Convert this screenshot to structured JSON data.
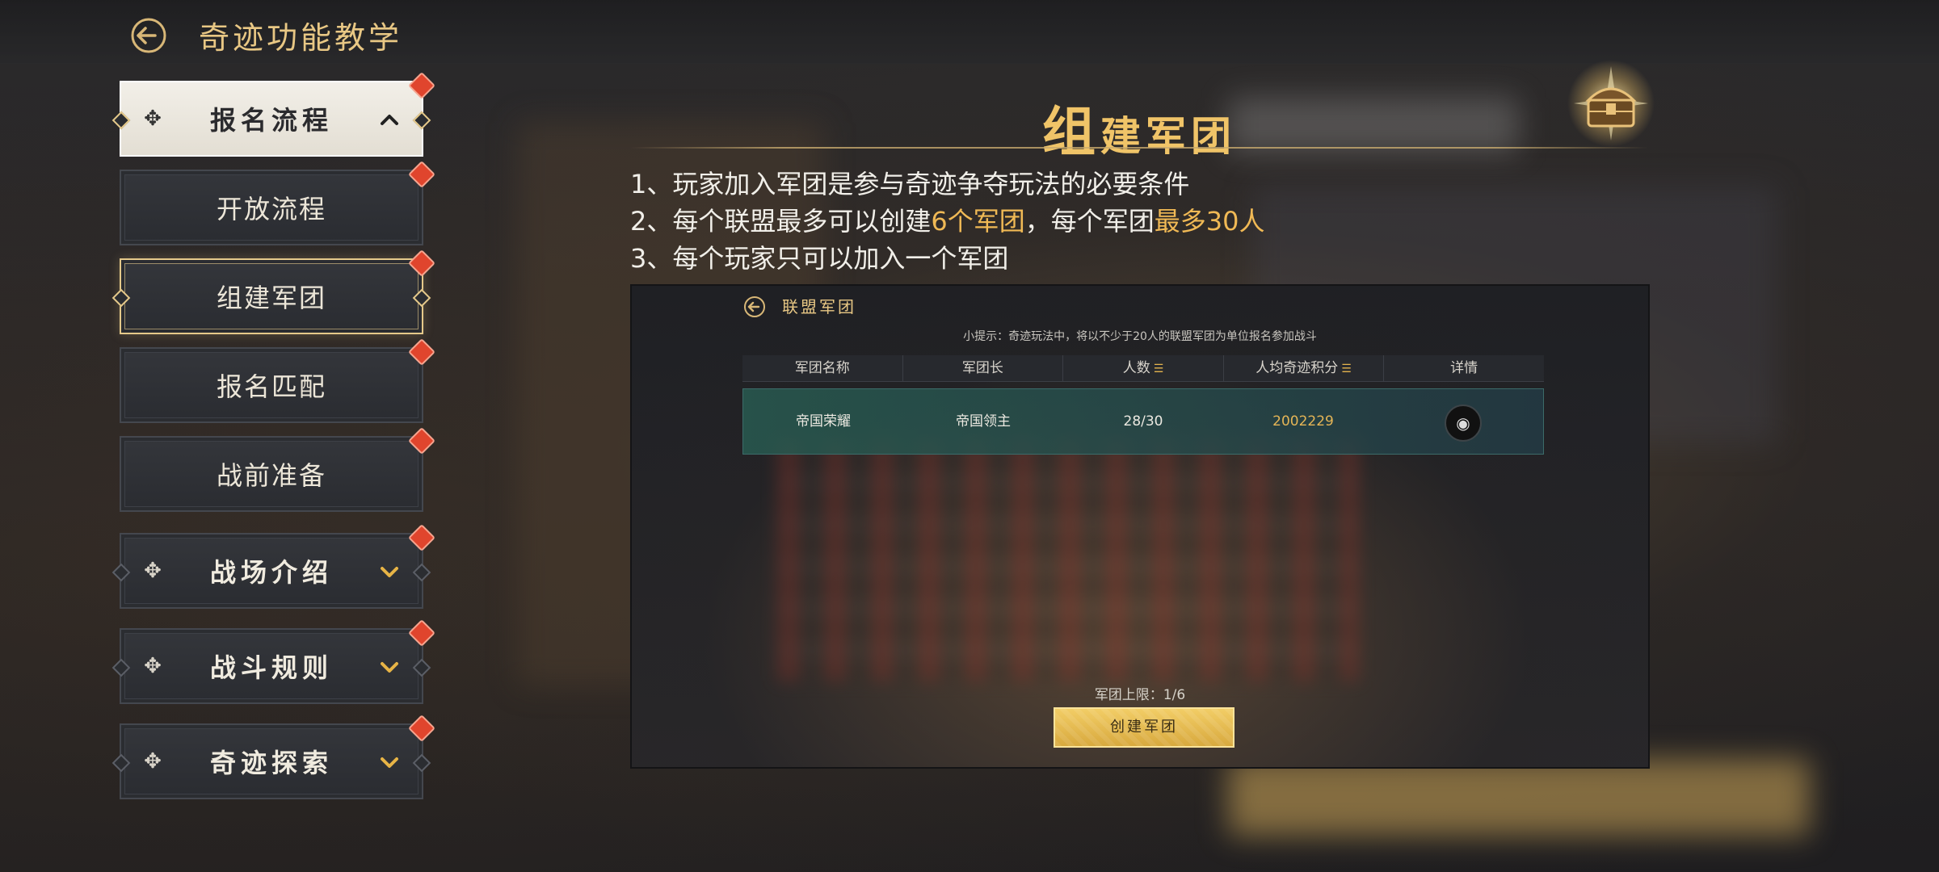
{
  "header": {
    "title": "奇迹功能教学"
  },
  "sidebar": {
    "items": [
      {
        "label": "报名流程",
        "type": "category",
        "state": "expanded"
      },
      {
        "label": "开放流程",
        "type": "sub"
      },
      {
        "label": "组建军团",
        "type": "sub",
        "state": "selected"
      },
      {
        "label": "报名匹配",
        "type": "sub"
      },
      {
        "label": "战前准备",
        "type": "sub"
      },
      {
        "label": "战场介绍",
        "type": "category"
      },
      {
        "label": "战斗规则",
        "type": "category"
      },
      {
        "label": "奇迹探索",
        "type": "category"
      }
    ]
  },
  "content": {
    "title_first": "组",
    "title_rest": "建军团",
    "lines": {
      "l1": "1、玩家加入军团是参与奇迹争夺玩法的必要条件",
      "l2_a": "2、每个联盟最多可以创建",
      "l2_b": "6个军团",
      "l2_c": "，每个军团",
      "l2_d": "最多30人",
      "l3": "3、每个玩家只可以加入一个军团"
    }
  },
  "example": {
    "title": "联盟军团",
    "tip": "小提示：奇迹玩法中，将以不少于20人的联盟军团为单位报名参加战斗",
    "columns": [
      "军团名称",
      "军团长",
      "人数",
      "人均奇迹积分",
      "详情"
    ],
    "rows": [
      {
        "name": "帝国荣耀",
        "leader": "帝国领主",
        "members": "28/30",
        "score": "2002229"
      }
    ],
    "limit": "军团上限：1/6",
    "create_button": "创建军团"
  },
  "colors": {
    "accent": "#f0b955",
    "badge": "#e0452d",
    "title_gold": "#e8c784"
  }
}
